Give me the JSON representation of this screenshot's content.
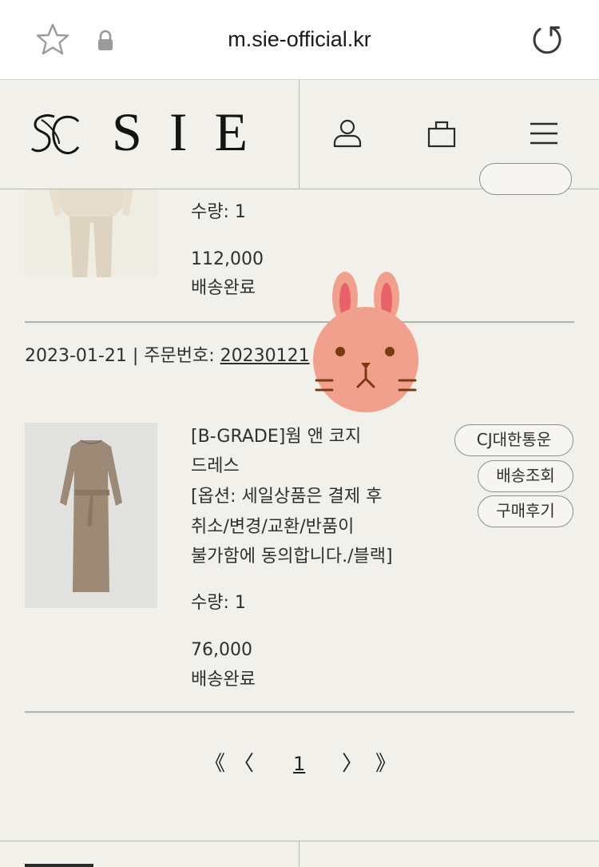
{
  "browser": {
    "url": "m.sie-official.kr",
    "icons": [
      "star-icon",
      "lock-icon",
      "reload-icon"
    ]
  },
  "header": {
    "logo_text": "SIE",
    "icons": [
      "user-icon",
      "shopping-bag-icon",
      "menu-icon"
    ]
  },
  "orders": [
    {
      "quantity_label": "수량: 1",
      "price": "112,000",
      "status": "배송완료"
    },
    {
      "date_label": "2023-01-21 | 주문번호: ",
      "order_no": "20230121",
      "product_name_line1": "[B-GRADE]웜 앤 코지",
      "product_name_line2": "드레스",
      "option_line1": "[옵션: 세일상품은 결제 후",
      "option_line2": "취소/변경/교환/반품이",
      "option_line3": "불가함에 동의합니다./블랙]",
      "quantity_label": "수량: 1",
      "price": "76,000",
      "status": "배송완료",
      "buttons": {
        "courier": "CJ대한통운",
        "track": "배송조회",
        "review": "구매후기"
      }
    }
  ],
  "pagination": {
    "first": "《",
    "prev": "〈",
    "current": "1",
    "next": "〉",
    "last": "》"
  },
  "colors": {
    "background": "#f1f0eb",
    "browser_bar": "#ffffff",
    "rabbit_face": "#f0a08c"
  }
}
